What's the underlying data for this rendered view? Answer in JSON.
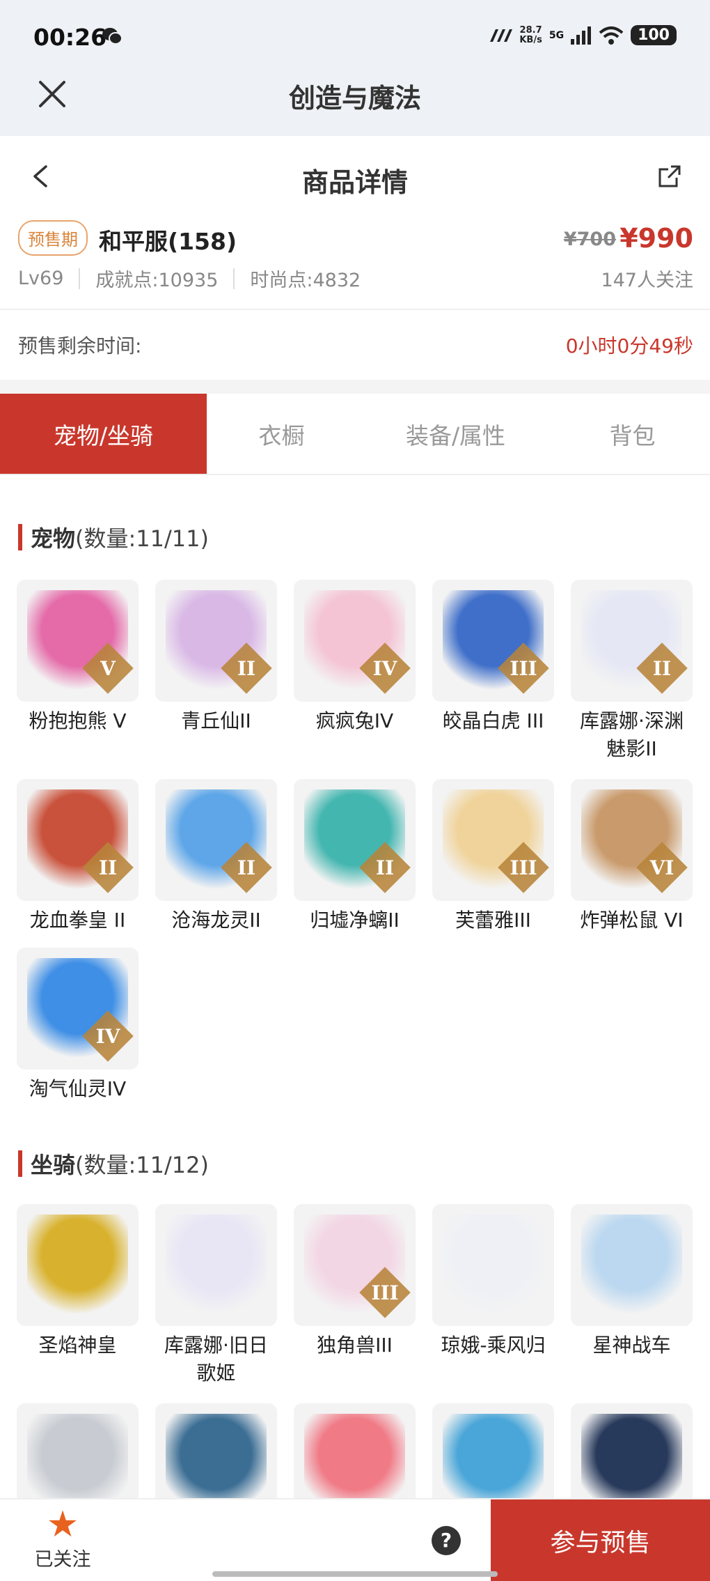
{
  "status_bar": {
    "time": "00:26",
    "net_speed": "28.7 KB/s",
    "net_speed_value": "28.7",
    "net_speed_unit": "KB/s",
    "network": "5G",
    "battery": "100"
  },
  "app": {
    "title": "创造与魔法"
  },
  "nav": {
    "title": "商品详情"
  },
  "product": {
    "badge": "预售期",
    "server": "和平服(158)",
    "old_price": "¥700",
    "price": "¥990",
    "level": "Lv69",
    "achievement": "成就点:10935",
    "fashion": "时尚点:4832",
    "followers": "147人关注"
  },
  "countdown": {
    "label": "预售剩余时间:",
    "value": "0小时0分49秒"
  },
  "tabs": [
    "宠物/坐骑",
    "衣橱",
    "装备/属性",
    "背包"
  ],
  "pets": {
    "title": "宠物",
    "count": "(数量:11/11)",
    "items": [
      {
        "name": "粉抱抱熊 V",
        "tier": "V",
        "color": "#e46aa8"
      },
      {
        "name": "青丘仙II",
        "tier": "II",
        "color": "#d9b8e6"
      },
      {
        "name": "疯疯兔IV",
        "tier": "IV",
        "color": "#f4c4d4"
      },
      {
        "name": "皎晶白虎 III",
        "tier": "III",
        "color": "#3f6fc9"
      },
      {
        "name": "库露娜·深渊魅影II",
        "tier": "II",
        "color": "#e5e7f5"
      },
      {
        "name": "龙血拳皇 II",
        "tier": "II",
        "color": "#c9523c"
      },
      {
        "name": "沧海龙灵II",
        "tier": "II",
        "color": "#5ea6e8"
      },
      {
        "name": "归墟净螭II",
        "tier": "II",
        "color": "#44b6b0"
      },
      {
        "name": "芙蕾雅III",
        "tier": "III",
        "color": "#f0d39a"
      },
      {
        "name": "炸弹松鼠 VI",
        "tier": "VI",
        "color": "#c99a6b"
      },
      {
        "name": "淘气仙灵IV",
        "tier": "IV",
        "color": "#3f8fe6"
      }
    ]
  },
  "mounts": {
    "title": "坐骑",
    "count": "(数量:11/12)",
    "items": [
      {
        "name": "圣焰神皇",
        "tier": "",
        "color": "#d8b22e"
      },
      {
        "name": "库露娜·旧日歌姬",
        "tier": "",
        "color": "#e8e6f5"
      },
      {
        "name": "独角兽III",
        "tier": "III",
        "color": "#f3d6e4"
      },
      {
        "name": "琼娥-乘风归",
        "tier": "",
        "color": "#eef0f6"
      },
      {
        "name": "星神战车",
        "tier": "",
        "color": "#bcd8f0"
      },
      {
        "name": "",
        "tier": "",
        "color": "#c8ccd2"
      },
      {
        "name": "",
        "tier": "",
        "color": "#3c6e94"
      },
      {
        "name": "",
        "tier": "",
        "color": "#f07a86"
      },
      {
        "name": "",
        "tier": "",
        "color": "#4aa6d8"
      },
      {
        "name": "",
        "tier": "",
        "color": "#283a5c"
      }
    ]
  },
  "bottom": {
    "follow_label": "已关注",
    "help": "?",
    "cta": "参与预售"
  },
  "colors": {
    "accent": "#c9372c",
    "badge": "#d9853b",
    "follow_star": "#e8621f"
  }
}
